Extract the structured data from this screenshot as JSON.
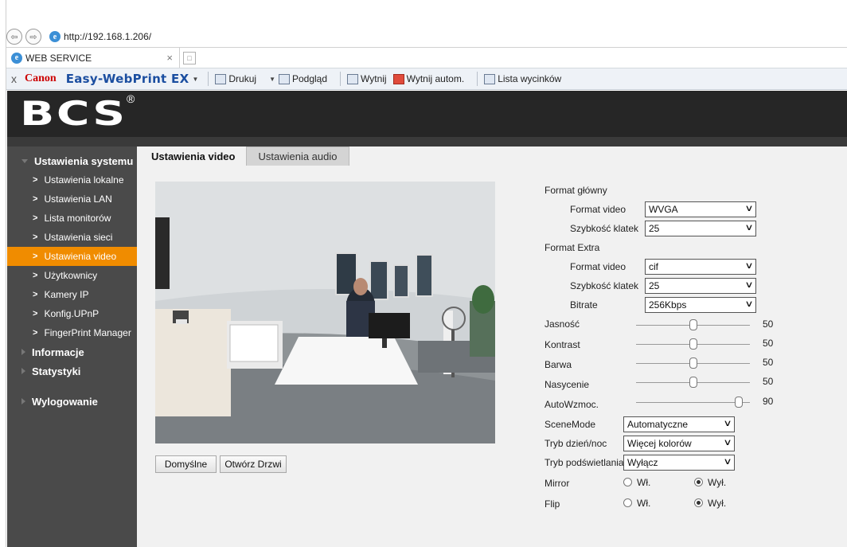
{
  "browser": {
    "url": "http://192.168.1.206/",
    "tab_title": "WEB SERVICE",
    "tab_close": "×",
    "toolbar": {
      "close": "x",
      "canon": "Canon",
      "easy_webprint": "Easy-WebPrint EX",
      "print": "Drukuj",
      "preview": "Podgląd",
      "clip": "Wytnij",
      "clip_auto": "Wytnij autom.",
      "clip_list": "Lista wycinków"
    }
  },
  "app": {
    "logo": "BCS",
    "logo_mark": "®"
  },
  "sidebar": {
    "sections": [
      {
        "label": "Ustawienia systemu"
      },
      {
        "label": "Informacje"
      },
      {
        "label": "Statystyki"
      },
      {
        "label": "Wylogowanie"
      }
    ],
    "items": [
      {
        "label": "Ustawienia lokalne"
      },
      {
        "label": "Ustawienia LAN"
      },
      {
        "label": "Lista monitorów"
      },
      {
        "label": "Ustawienia sieci"
      },
      {
        "label": "Ustawienia video",
        "active": true
      },
      {
        "label": "Użytkownicy"
      },
      {
        "label": "Kamery IP"
      },
      {
        "label": "Konfig.UPnP"
      },
      {
        "label": "FingerPrint Manager"
      }
    ]
  },
  "tabs": [
    {
      "label": "Ustawienia video",
      "active": true
    },
    {
      "label": "Ustawienia audio",
      "active": false
    }
  ],
  "buttons": {
    "defaults": "Domyślne",
    "open_door": "Otwórz Drzwi"
  },
  "settings": {
    "main_format": {
      "title": "Format główny",
      "video_format_label": "Format video",
      "video_format_value": "WVGA",
      "fps_label": "Szybkość klatek",
      "fps_value": "25"
    },
    "extra_format": {
      "title": "Format Extra",
      "video_format_label": "Format video",
      "video_format_value": "cif",
      "fps_label": "Szybkość klatek",
      "fps_value": "25",
      "bitrate_label": "Bitrate",
      "bitrate_value": "256Kbps"
    },
    "sliders": [
      {
        "label": "Jasność",
        "value": 50
      },
      {
        "label": "Kontrast",
        "value": 50
      },
      {
        "label": "Barwa",
        "value": 50
      },
      {
        "label": "Nasycenie",
        "value": 50
      },
      {
        "label": "AutoWzmoc.",
        "value": 90
      }
    ],
    "scene_mode": {
      "label": "SceneMode",
      "value": "Automatyczne"
    },
    "day_night": {
      "label": "Tryb dzień/noc",
      "value": "Więcej kolorów"
    },
    "backlight": {
      "label": "Tryb podświetlania",
      "value": "Wyłącz"
    },
    "mirror": {
      "label": "Mirror",
      "on_label": "Wł.",
      "off_label": "Wył.",
      "selected": "off"
    },
    "flip": {
      "label": "Flip",
      "on_label": "Wł.",
      "off_label": "Wył.",
      "selected": "off"
    }
  },
  "colors": {
    "accent": "#f08c00",
    "header": "#262626",
    "sidebar": "#4a4a4a"
  }
}
